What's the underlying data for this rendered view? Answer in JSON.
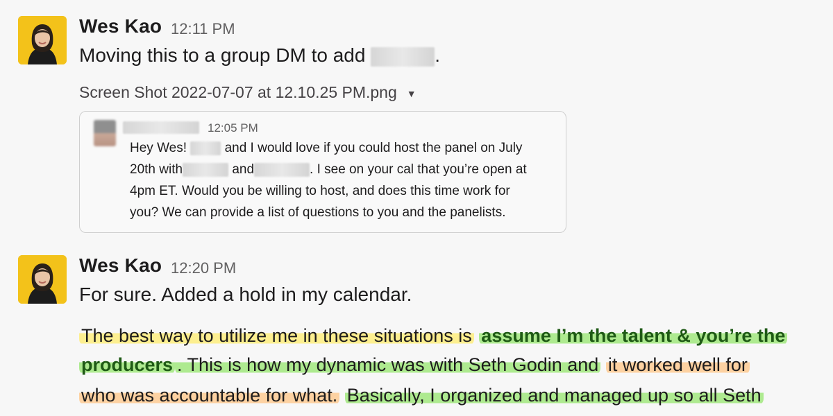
{
  "messages": [
    {
      "author": "Wes Kao",
      "time": "12:11 PM",
      "text_before": "Moving this to a group DM to add",
      "text_after": ".",
      "attachment": {
        "filename": "Screen Shot 2022-07-07 at 12.10.25 PM.png",
        "caret": "▼"
      },
      "quoted": {
        "time": "12:05 PM",
        "lines": [
          {
            "a": "Hey Wes!",
            "b": "and I would love if you could host the panel on July"
          },
          {
            "a": "20th with",
            "b": "and",
            "c": ". I see on your cal that you’re open at"
          },
          {
            "a": "4pm ET. Would you be willing to host, and does this time work for"
          },
          {
            "a": "you? We can provide a list of questions to you and the panelists."
          }
        ]
      }
    },
    {
      "author": "Wes Kao",
      "time": "12:20 PM",
      "text": "For sure. Added a hold in my calendar.",
      "paragraph": {
        "l1_a": "The best way to utilize me in these situations is",
        "l1_b": "assume I’m the talent & you’re the",
        "l2_a": "producers",
        "l2_b": ". This is how my dynamic was with Seth Godin and",
        "l2_c": "it worked well for",
        "l3_a": "who was accountable for what.",
        "l3_b": "Basically, I organized and managed up so all Seth"
      }
    }
  ],
  "colors": {
    "highlight_yellow": "#ffec6e",
    "highlight_green": "#96e66e",
    "highlight_orange": "#ffc88c"
  }
}
